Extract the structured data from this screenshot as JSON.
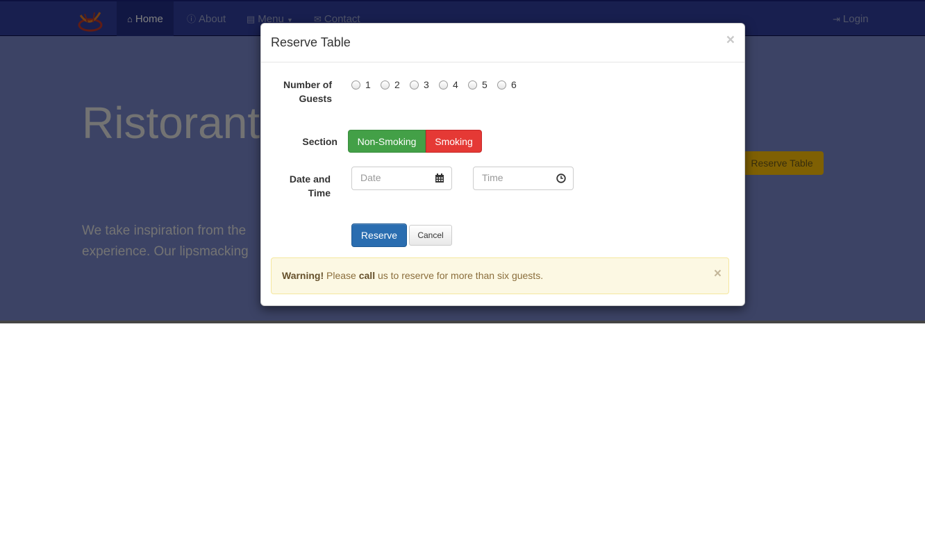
{
  "navbar": {
    "items": [
      {
        "label": "Home",
        "icon": "home-icon",
        "active": true
      },
      {
        "label": "About",
        "icon": "info-icon"
      },
      {
        "label": "Menu",
        "icon": "list-icon"
      },
      {
        "label": "Contact",
        "icon": "envelope-icon"
      }
    ],
    "login": "Login"
  },
  "hero": {
    "title": "Ristorante",
    "text": "We take inspiration from the experience. Our lipsmacking",
    "reserve_button": "Reserve Table"
  },
  "modal": {
    "title": "Reserve Table",
    "close": "×",
    "guests_label": "Number of Guests",
    "guest_options": [
      "1",
      "2",
      "3",
      "4",
      "5",
      "6"
    ],
    "section_label": "Section",
    "section_options": [
      "Non-Smoking",
      "Smoking"
    ],
    "datetime_label": "Date and Time",
    "date_placeholder": "Date",
    "time_placeholder": "Time",
    "reserve_button": "Reserve",
    "cancel_button": "Cancel",
    "alert": {
      "strong": "Warning!",
      "text_pre": "Please",
      "emph": "call",
      "text_post": "us to reserve for more than six guests.",
      "close": "×"
    }
  },
  "colors": {
    "navbar": "#303f9f",
    "jumbotron": "#7986cb",
    "non_smoking": "#43a047",
    "smoking": "#e53935",
    "primary": "#2a6db0",
    "warning_bg": "#fcf8e3"
  }
}
